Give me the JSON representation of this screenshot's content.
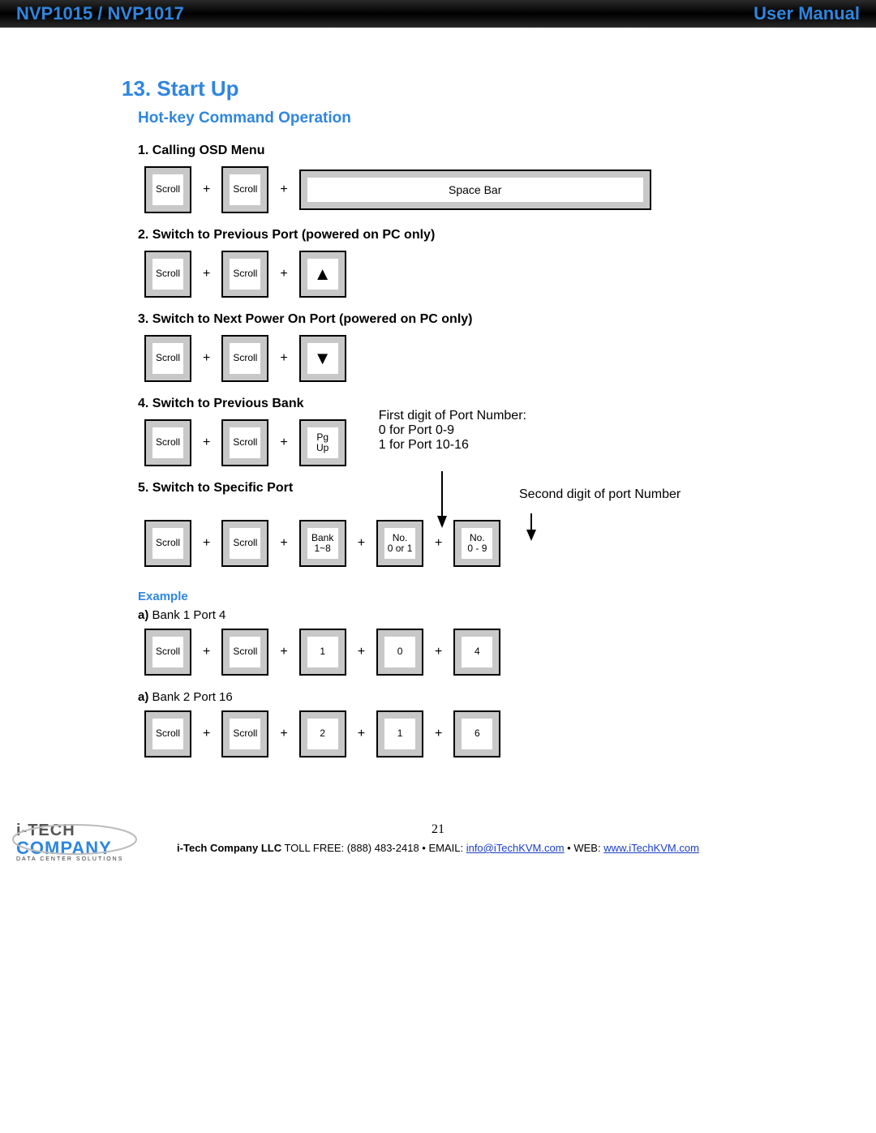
{
  "header": {
    "left": "NVP1015 / NVP1017",
    "right": "User Manual"
  },
  "title": "13. Start Up",
  "subtitle": "Hot-key Command Operation",
  "steps": {
    "s1": "1. Calling OSD Menu",
    "s2": "2. Switch to Previous Port (powered on PC only)",
    "s3": "3. Switch to Next Power On Port (powered on PC only)",
    "s4": "4. Switch to Previous Bank",
    "s5": "5. Switch to Specific Port"
  },
  "keys": {
    "scroll": "Scroll",
    "spacebar": "Space Bar",
    "pgup": "Pg\nUp",
    "bank": "Bank\n1~8",
    "no01": "No.\n0 or 1",
    "no09": "No.\n0 - 9",
    "k1": "1",
    "k0": "0",
    "k4": "4",
    "k2": "2",
    "k6": "6"
  },
  "plus": "+",
  "notes": {
    "first": "First digit of Port Number:\n0 for Port 0-9\n1 for Port 10-16",
    "second": "Second digit of port Number"
  },
  "example": {
    "head": "Example",
    "a": "a)",
    "line1": " Bank 1 Port 4",
    "line2": " Bank 2 Port 16"
  },
  "footer": {
    "page": "21",
    "company": "i-Tech Company LLC",
    "toll_label": " TOLL FREE: ",
    "toll": "(888) 483-2418",
    "email_label": " • EMAIL: ",
    "email": "info@iTechKVM.com",
    "web_label": " • WEB: ",
    "web": "www.iTechKVM.com",
    "logo_top": "i-TECH",
    "logo_mid": "COMPANY",
    "logo_sub": "DATA CENTER SOLUTIONS"
  }
}
